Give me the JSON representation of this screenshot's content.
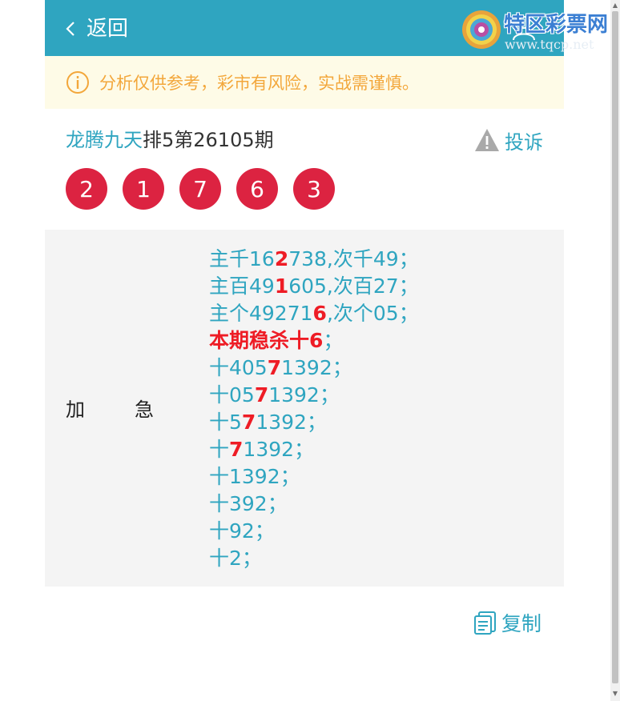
{
  "header": {
    "back_label": "返回",
    "logo_title": "特区彩票网",
    "logo_url": "www.tqcp.net",
    "bg_color": "#2fa5c0"
  },
  "notice": {
    "text": "分析仅供参考，彩市有风险，实战需谨慎。",
    "color": "#f3a73b",
    "icon": "info-icon"
  },
  "title": {
    "author": "龙腾九天",
    "issue": "排5第26105期"
  },
  "complain_label": "投诉",
  "balls": [
    "2",
    "1",
    "7",
    "6",
    "3"
  ],
  "ball_color": "#dc2341",
  "category": {
    "char1": "加",
    "char2": "急"
  },
  "lines": [
    {
      "pre": "主千16",
      "hl": "2",
      "post": "738,次千49；"
    },
    {
      "pre": "主百49",
      "hl": "1",
      "post": "605,次百27；"
    },
    {
      "pre": "主个49271",
      "hl": "6",
      "post": ",次个05；"
    },
    {
      "kill": "本期稳杀十6",
      "tail": "；"
    },
    {
      "pre": "十405",
      "hl": "7",
      "post": "1392；"
    },
    {
      "pre": "十05",
      "hl": "7",
      "post": "1392；"
    },
    {
      "pre": "十5",
      "hl": "7",
      "post": "1392；"
    },
    {
      "pre": "十",
      "hl": "7",
      "post": "1392；"
    },
    {
      "pre": "十1392；"
    },
    {
      "pre": "十392；"
    },
    {
      "pre": "十92；"
    },
    {
      "pre": "十2；"
    }
  ],
  "copy_label": "复制",
  "accent_color": "#2fa5c0",
  "highlight_color": "#ee1c25"
}
